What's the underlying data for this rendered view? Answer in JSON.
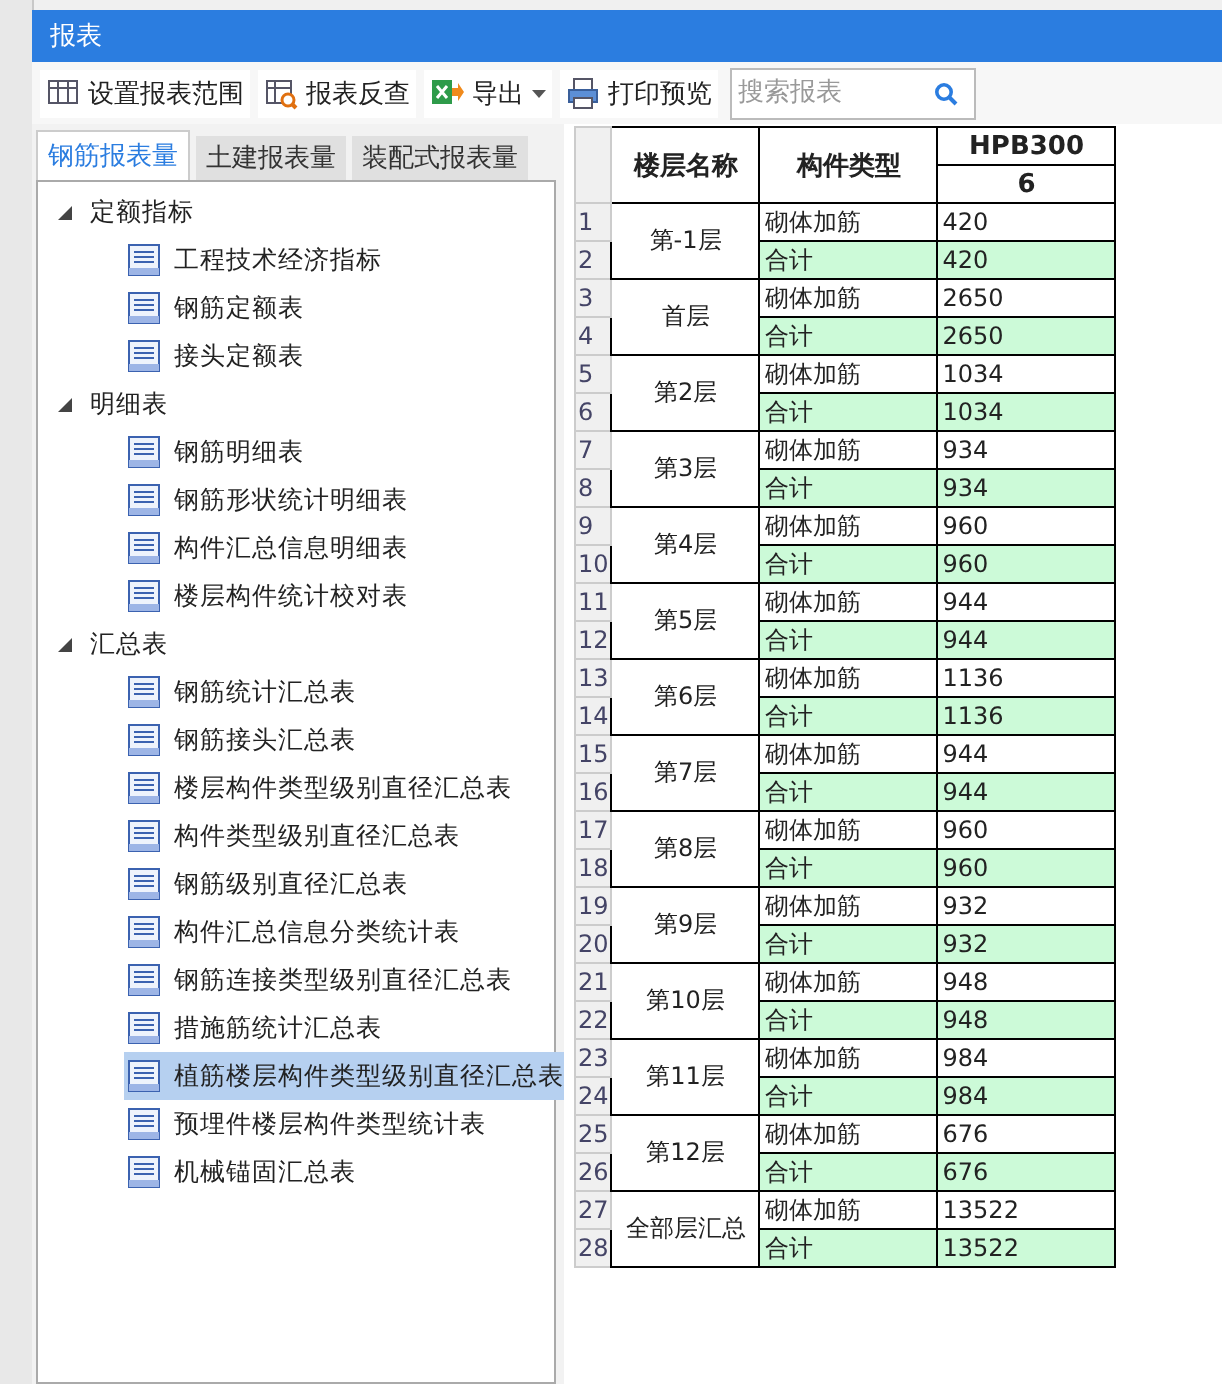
{
  "window": {
    "title": "报表"
  },
  "toolbar": [
    {
      "kind": "range",
      "label": "设置报表范围"
    },
    {
      "kind": "lookup",
      "label": "报表反查"
    },
    {
      "kind": "export",
      "label": "导出"
    },
    {
      "kind": "print",
      "label": "打印预览"
    }
  ],
  "search": {
    "placeholder": "搜索报表"
  },
  "tabs": [
    {
      "label": "钢筋报表量",
      "selected": true
    },
    {
      "label": "土建报表量",
      "selected": false
    },
    {
      "label": "装配式报表量",
      "selected": false
    }
  ],
  "tree": [
    {
      "label": "定额指标",
      "expanded": true,
      "children": [
        {
          "label": "工程技术经济指标",
          "selected": false
        },
        {
          "label": "钢筋定额表",
          "selected": false
        },
        {
          "label": "接头定额表",
          "selected": false
        }
      ]
    },
    {
      "label": "明细表",
      "expanded": true,
      "children": [
        {
          "label": "钢筋明细表",
          "selected": false
        },
        {
          "label": "钢筋形状统计明细表",
          "selected": false
        },
        {
          "label": "构件汇总信息明细表",
          "selected": false
        },
        {
          "label": "楼层构件统计校对表",
          "selected": false
        }
      ]
    },
    {
      "label": "汇总表",
      "expanded": true,
      "children": [
        {
          "label": "钢筋统计汇总表",
          "selected": false
        },
        {
          "label": "钢筋接头汇总表",
          "selected": false
        },
        {
          "label": "楼层构件类型级别直径汇总表",
          "selected": false
        },
        {
          "label": "构件类型级别直径汇总表",
          "selected": false
        },
        {
          "label": "钢筋级别直径汇总表",
          "selected": false
        },
        {
          "label": "构件汇总信息分类统计表",
          "selected": false
        },
        {
          "label": "钢筋连接类型级别直径汇总表",
          "selected": false
        },
        {
          "label": "措施筋统计汇总表",
          "selected": false
        },
        {
          "label": "植筋楼层构件类型级别直径汇总表",
          "selected": true
        },
        {
          "label": "预埋件楼层构件类型统计表",
          "selected": false
        },
        {
          "label": "机械锚固汇总表",
          "selected": false
        }
      ]
    }
  ],
  "table": {
    "columns": [
      "楼层名称",
      "构件类型",
      "HPB300"
    ],
    "subheader": "6",
    "floors": [
      {
        "name": "第-1层",
        "rows": [
          {
            "number": "1",
            "kind": "item",
            "type": "砌体加筋",
            "value": "420"
          },
          {
            "number": "2",
            "kind": "total",
            "type": "合计",
            "value": "420"
          }
        ]
      },
      {
        "name": "首层",
        "rows": [
          {
            "number": "3",
            "kind": "item",
            "type": "砌体加筋",
            "value": "2650"
          },
          {
            "number": "4",
            "kind": "total",
            "type": "合计",
            "value": "2650"
          }
        ]
      },
      {
        "name": "第2层",
        "rows": [
          {
            "number": "5",
            "kind": "item",
            "type": "砌体加筋",
            "value": "1034"
          },
          {
            "number": "6",
            "kind": "total",
            "type": "合计",
            "value": "1034"
          }
        ]
      },
      {
        "name": "第3层",
        "rows": [
          {
            "number": "7",
            "kind": "item",
            "type": "砌体加筋",
            "value": "934"
          },
          {
            "number": "8",
            "kind": "total",
            "type": "合计",
            "value": "934"
          }
        ]
      },
      {
        "name": "第4层",
        "rows": [
          {
            "number": "9",
            "kind": "item",
            "type": "砌体加筋",
            "value": "960"
          },
          {
            "number": "10",
            "kind": "total",
            "type": "合计",
            "value": "960"
          }
        ]
      },
      {
        "name": "第5层",
        "rows": [
          {
            "number": "11",
            "kind": "item",
            "type": "砌体加筋",
            "value": "944"
          },
          {
            "number": "12",
            "kind": "total",
            "type": "合计",
            "value": "944"
          }
        ]
      },
      {
        "name": "第6层",
        "rows": [
          {
            "number": "13",
            "kind": "item",
            "type": "砌体加筋",
            "value": "1136"
          },
          {
            "number": "14",
            "kind": "total",
            "type": "合计",
            "value": "1136"
          }
        ]
      },
      {
        "name": "第7层",
        "rows": [
          {
            "number": "15",
            "kind": "item",
            "type": "砌体加筋",
            "value": "944"
          },
          {
            "number": "16",
            "kind": "total",
            "type": "合计",
            "value": "944"
          }
        ]
      },
      {
        "name": "第8层",
        "rows": [
          {
            "number": "17",
            "kind": "item",
            "type": "砌体加筋",
            "value": "960"
          },
          {
            "number": "18",
            "kind": "total",
            "type": "合计",
            "value": "960"
          }
        ]
      },
      {
        "name": "第9层",
        "rows": [
          {
            "number": "19",
            "kind": "item",
            "type": "砌体加筋",
            "value": "932"
          },
          {
            "number": "20",
            "kind": "total",
            "type": "合计",
            "value": "932"
          }
        ]
      },
      {
        "name": "第10层",
        "rows": [
          {
            "number": "21",
            "kind": "item",
            "type": "砌体加筋",
            "value": "948"
          },
          {
            "number": "22",
            "kind": "total",
            "type": "合计",
            "value": "948"
          }
        ]
      },
      {
        "name": "第11层",
        "rows": [
          {
            "number": "23",
            "kind": "item",
            "type": "砌体加筋",
            "value": "984"
          },
          {
            "number": "24",
            "kind": "total",
            "type": "合计",
            "value": "984"
          }
        ]
      },
      {
        "name": "第12层",
        "rows": [
          {
            "number": "25",
            "kind": "item",
            "type": "砌体加筋",
            "value": "676"
          },
          {
            "number": "26",
            "kind": "total",
            "type": "合计",
            "value": "676"
          }
        ]
      },
      {
        "name": "全部层汇总",
        "rows": [
          {
            "number": "27",
            "kind": "item",
            "type": "砌体加筋",
            "value": "13522"
          },
          {
            "number": "28",
            "kind": "total",
            "type": "合计",
            "value": "13522"
          }
        ]
      }
    ]
  }
}
